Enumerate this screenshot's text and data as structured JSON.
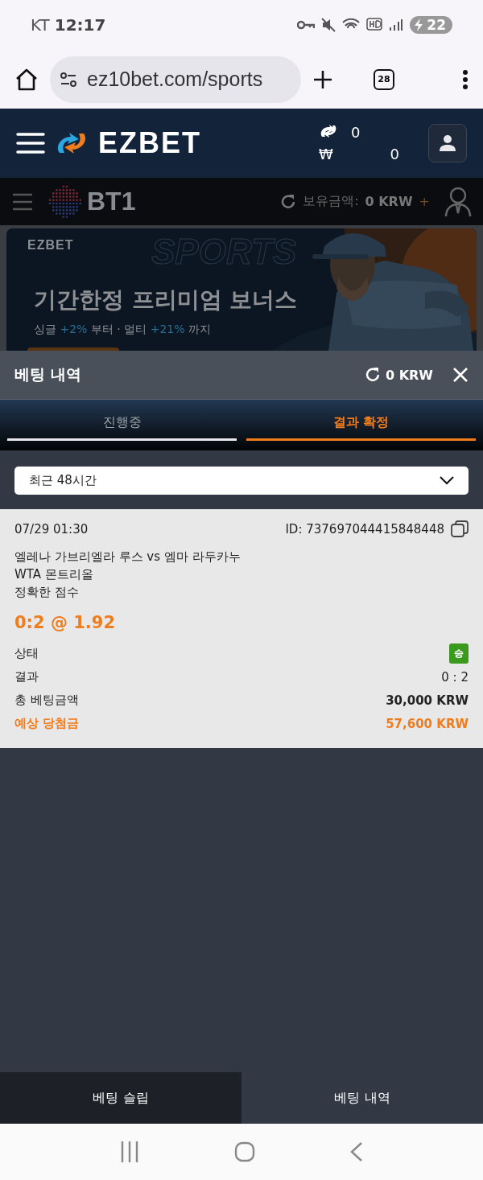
{
  "status_bar": {
    "carrier": "KT",
    "time": "12:17",
    "battery": "22"
  },
  "browser": {
    "url": "ez10bet.com/sports",
    "tab_count": "28"
  },
  "site_header": {
    "logo": "EZBET",
    "points": "0",
    "currency_symbol": "₩",
    "balance": "0"
  },
  "sub_header": {
    "logo": "BT1",
    "balance_label": "보유금액:",
    "balance": "0 KRW",
    "add": "+"
  },
  "banner": {
    "brand": "EZBET",
    "watermark": "SPORTS",
    "headline": "기간한정 프리미엄 보너스",
    "subline": [
      {
        "text": "싱글 ",
        "highlight": false
      },
      {
        "text": "+2%",
        "highlight": true
      },
      {
        "text": " 부터 · 멀티 ",
        "highlight": false
      },
      {
        "text": "+21%",
        "highlight": true
      },
      {
        "text": " 까지",
        "highlight": false
      }
    ]
  },
  "sheet": {
    "title": "베팅 내역",
    "balance": "0 KRW",
    "tabs": [
      {
        "label": "진행중",
        "selected": false
      },
      {
        "label": "결과 확정",
        "selected": true
      }
    ],
    "filter": {
      "value": "최근 48시간"
    },
    "bets": [
      {
        "date": "07/29 01:30",
        "id": "ID: 737697044415848448",
        "match": "엘레나 가브리엘라 루스 vs 엠마 라두카누",
        "league": "WTA 몬트리올",
        "market": "정확한 점수",
        "pick": "0:2 @ 1.92",
        "rows": [
          {
            "label": "상태",
            "kind": "badge",
            "value": "승"
          },
          {
            "label": "결과",
            "kind": "text",
            "value": "0 : 2"
          },
          {
            "label": "총 베팅금액",
            "kind": "bold",
            "value": "30,000 KRW"
          },
          {
            "label": "예상 당첨금",
            "kind": "highlight",
            "value": "57,600 KRW"
          }
        ]
      }
    ]
  },
  "bottom_tabs": [
    {
      "label": "베팅 슬립",
      "selected": false
    },
    {
      "label": "베팅 내역",
      "selected": true
    }
  ]
}
